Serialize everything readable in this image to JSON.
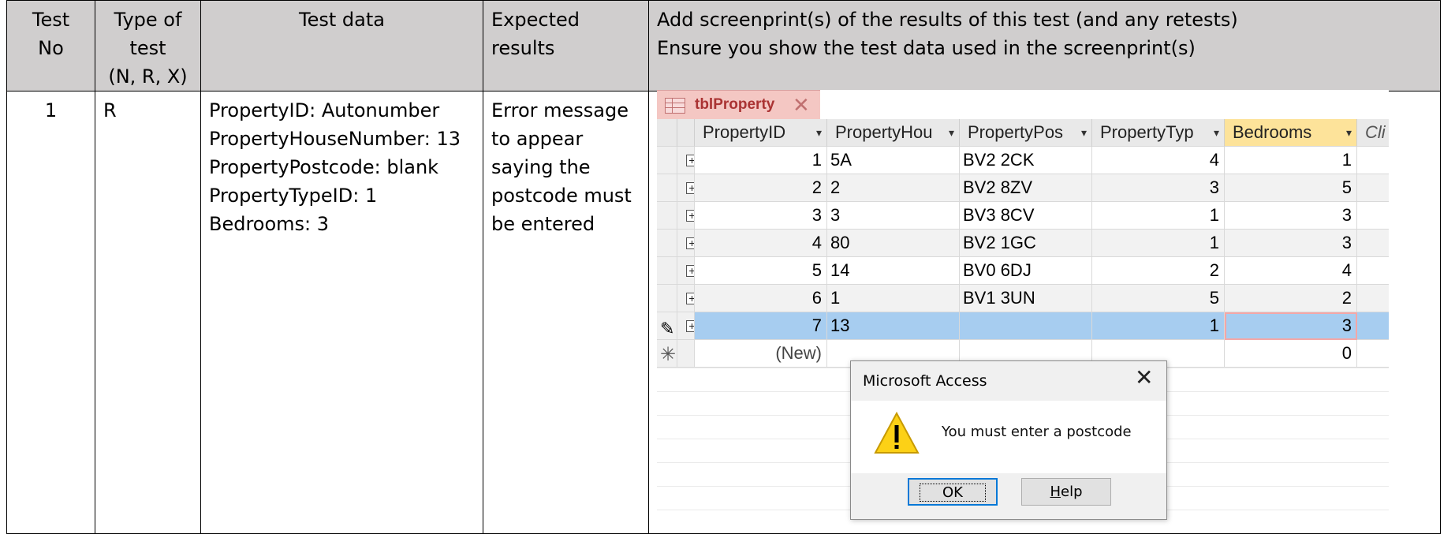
{
  "table": {
    "headers": {
      "test_no": [
        "Test",
        "No"
      ],
      "type_of_test": [
        "Type of",
        "test",
        "(N, R, X)"
      ],
      "test_data": "Test data",
      "expected_results": [
        "Expected",
        "results"
      ],
      "screenprint": [
        "Add screenprint(s) of the results of this test (and any retests)",
        "Ensure you show the test data used in the screenprint(s)"
      ]
    },
    "rows": [
      {
        "test_no": "1",
        "type": "R",
        "test_data": [
          "PropertyID: Autonumber",
          "PropertyHouseNumber: 13",
          "PropertyPostcode: blank",
          "PropertyTypeID: 1",
          "Bedrooms: 3"
        ],
        "expected": [
          "Error message",
          "to appear",
          "saying the",
          "postcode must",
          "be entered"
        ]
      }
    ]
  },
  "access": {
    "tab_label": "tblProperty",
    "icons": {
      "tab": "table-icon",
      "close": "close-icon",
      "expand": "plus-icon",
      "edit": "pencil-icon",
      "new": "asterisk-icon"
    },
    "columns": [
      "PropertyID",
      "PropertyHou",
      "PropertyPos",
      "PropertyTyp",
      "Bedrooms",
      "Cli"
    ],
    "rows": [
      {
        "id": "1",
        "house": "5A",
        "postcode": "BV2 2CK",
        "type": "4",
        "bedrooms": "1"
      },
      {
        "id": "2",
        "house": "2",
        "postcode": "BV2 8ZV",
        "type": "3",
        "bedrooms": "5"
      },
      {
        "id": "3",
        "house": "3",
        "postcode": "BV3 8CV",
        "type": "1",
        "bedrooms": "3"
      },
      {
        "id": "4",
        "house": "80",
        "postcode": "BV2 1GC",
        "type": "1",
        "bedrooms": "3"
      },
      {
        "id": "5",
        "house": "14",
        "postcode": "BV0 6DJ",
        "type": "2",
        "bedrooms": "4"
      },
      {
        "id": "6",
        "house": "1",
        "postcode": "BV1 3UN",
        "type": "5",
        "bedrooms": "2"
      },
      {
        "id": "7",
        "house": "13",
        "postcode": "",
        "type": "1",
        "bedrooms": "3"
      }
    ],
    "new_row": {
      "id": "(New)",
      "bedrooms": "0"
    },
    "colors": {
      "tab_bg": "#f4c7c3",
      "sorted_header": "#fde39a",
      "selected_row": "#a7cdf0",
      "table_header_bg": "#d0cece"
    }
  },
  "dialog": {
    "title": "Microsoft Access",
    "message": "You must enter a postcode",
    "ok_label": "OK",
    "help_label_prefix": "H",
    "help_label_rest": "elp",
    "icon": "warning-icon"
  }
}
